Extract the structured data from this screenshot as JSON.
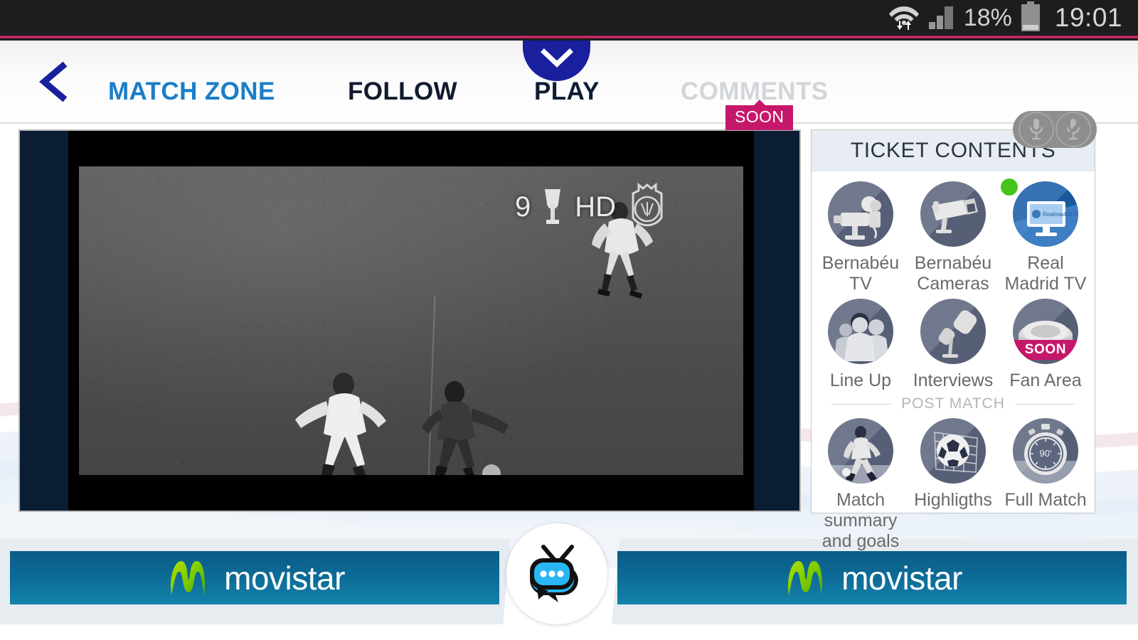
{
  "status_bar": {
    "wifi_icon": "wifi-transfer-icon",
    "signal_icon": "cellular-signal-icon",
    "battery_percent": "18%",
    "battery_icon": "battery-icon",
    "clock": "19:01"
  },
  "header": {
    "back_icon": "back-chevron-icon",
    "tabs": [
      {
        "label": "MATCH ZONE",
        "state": "active"
      },
      {
        "label": "FOLLOW",
        "state": "normal"
      },
      {
        "label": "PLAY",
        "state": "selected"
      },
      {
        "label": "COMMENTS",
        "state": "disabled"
      }
    ],
    "comments_badge": "SOON",
    "play_chevron_icon": "chevron-down-icon",
    "mic_toggle": {
      "on_icon": "microphone-icon",
      "off_icon": "microphone-muted-icon"
    }
  },
  "player": {
    "overlay": {
      "channel_number": "9",
      "trophy_icon": "trophy-icon",
      "quality": "HD",
      "crest_icon": "real-madrid-crest-icon"
    }
  },
  "ticket": {
    "title": "TICKET CONTENTS",
    "items": [
      {
        "label": "Bernabéu TV",
        "icon": "tv-camera-icon",
        "badge": "",
        "live": false,
        "style": "gray"
      },
      {
        "label": "Bernabéu Cameras",
        "icon": "security-camera-icon",
        "badge": "",
        "live": false,
        "style": "gray"
      },
      {
        "label": "Real Madrid TV",
        "icon": "monitor-icon",
        "badge": "",
        "live": true,
        "style": "blue",
        "screen_text": "Realmadrid TV"
      },
      {
        "label": "Line Up",
        "icon": "players-group-icon",
        "badge": "",
        "live": false,
        "style": "gray"
      },
      {
        "label": "Interviews",
        "icon": "microphones-icon",
        "badge": "",
        "live": false,
        "style": "gray"
      },
      {
        "label": "Fan Area",
        "icon": "stadium-icon",
        "badge": "SOON",
        "live": false,
        "style": "gray"
      }
    ],
    "section_divider": "POST MATCH",
    "post_match_items": [
      {
        "label": "Match summary and goals",
        "icon": "player-kicking-icon",
        "badge": "",
        "live": false,
        "style": "gray"
      },
      {
        "label": "Highligths",
        "icon": "soccer-goal-icon",
        "badge": "",
        "live": false,
        "style": "gray"
      },
      {
        "label": "Full Match",
        "icon": "stopwatch-icon",
        "badge": "",
        "live": false,
        "style": "gray",
        "stopwatch_text": "90'"
      }
    ]
  },
  "banners": {
    "left": {
      "brand": "movistar",
      "logo_icon": "movistar-m-logo"
    },
    "right": {
      "brand": "movistar",
      "logo_icon": "movistar-m-logo"
    }
  },
  "chat_fab": {
    "icon": "tv-chat-bubble-icon"
  },
  "colors": {
    "accent_magenta": "#c5186b",
    "active_tab_blue": "#1a7ec8",
    "play_navy": "#1a1f9e",
    "live_green": "#45c41c",
    "movistar_blue": "#0c6a95",
    "icon_slate": "#5d667e"
  }
}
